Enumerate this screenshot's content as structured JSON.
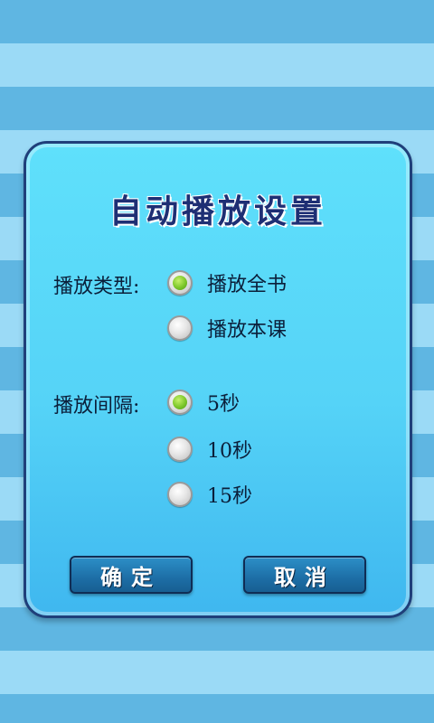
{
  "dialog": {
    "title": "自动播放设置",
    "play_type": {
      "label": "播放类型:",
      "options": [
        {
          "text": "播放全书",
          "checked": true
        },
        {
          "text": "播放本课",
          "checked": false
        }
      ]
    },
    "play_interval": {
      "label": "播放间隔:",
      "options": [
        {
          "text": "5秒",
          "checked": true
        },
        {
          "text": "10秒",
          "checked": false
        },
        {
          "text": "15秒",
          "checked": false
        }
      ]
    },
    "buttons": {
      "confirm": "确定",
      "cancel": "取消"
    }
  },
  "colors": {
    "accent_dark": "#1e2f74",
    "radio_selected": "#7cc72a",
    "button": "#1d6ea6"
  },
  "icons": {
    "radio_selected": "radio-checked-icon",
    "radio_unselected": "radio-unchecked-icon"
  }
}
